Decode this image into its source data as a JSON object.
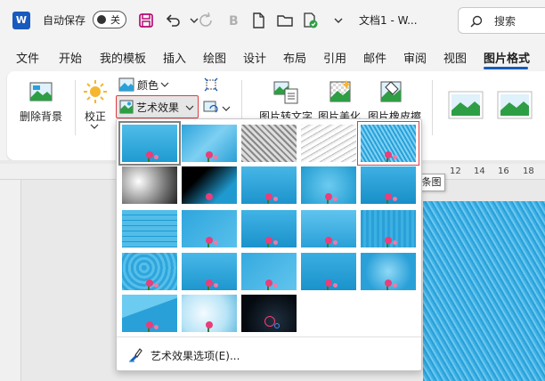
{
  "titlebar": {
    "autosave_label": "自动保存",
    "autosave_state": "关",
    "doc_title": "文档1 - W...",
    "search_placeholder": "搜索"
  },
  "menu": {
    "tabs": [
      "文件",
      "开始",
      "我的模板",
      "插入",
      "绘图",
      "设计",
      "布局",
      "引用",
      "邮件",
      "审阅",
      "视图",
      "图片格式"
    ],
    "active": "图片格式"
  },
  "ribbon": {
    "remove_bg": "删除背景",
    "correct": "校正",
    "color": "颜色",
    "art_effects": "艺术效果",
    "pic_to_text": "图片转文字",
    "beautify": "图片美化",
    "eraser": "图片橡皮擦"
  },
  "ruler": {
    "ticks": [
      "12",
      "14",
      "16",
      "18"
    ]
  },
  "tooltip": "线条图",
  "gallery": {
    "options_label": "艺术效果选项(E)..."
  },
  "colors": {
    "accent": "#185abd",
    "highlight": "#e03c3c",
    "sky": "#2aa0d8"
  }
}
